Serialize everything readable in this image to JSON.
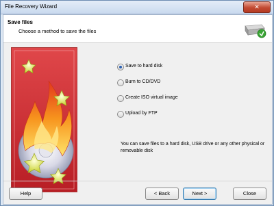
{
  "window": {
    "title": "File Recovery Wizard",
    "close_glyph": "✕"
  },
  "header": {
    "title": "Save files",
    "subtitle": "Choose a method to save the files",
    "icon": "hard-drive-save-icon"
  },
  "options": [
    {
      "label": "Save to hard disk",
      "selected": true
    },
    {
      "label": "Burn to CD/DVD",
      "selected": false
    },
    {
      "label": "Create ISO virtual image",
      "selected": false
    },
    {
      "label": "Upload by FTP",
      "selected": false
    }
  ],
  "description": "You can save files to a hard disk, USB drive or any other physical or removable disk",
  "buttons": {
    "help": "Help",
    "back": "< Back",
    "next": "Next >",
    "close": "Close"
  },
  "colors": {
    "banner_red": "#c8232a",
    "accent": "#2a5fb0"
  }
}
